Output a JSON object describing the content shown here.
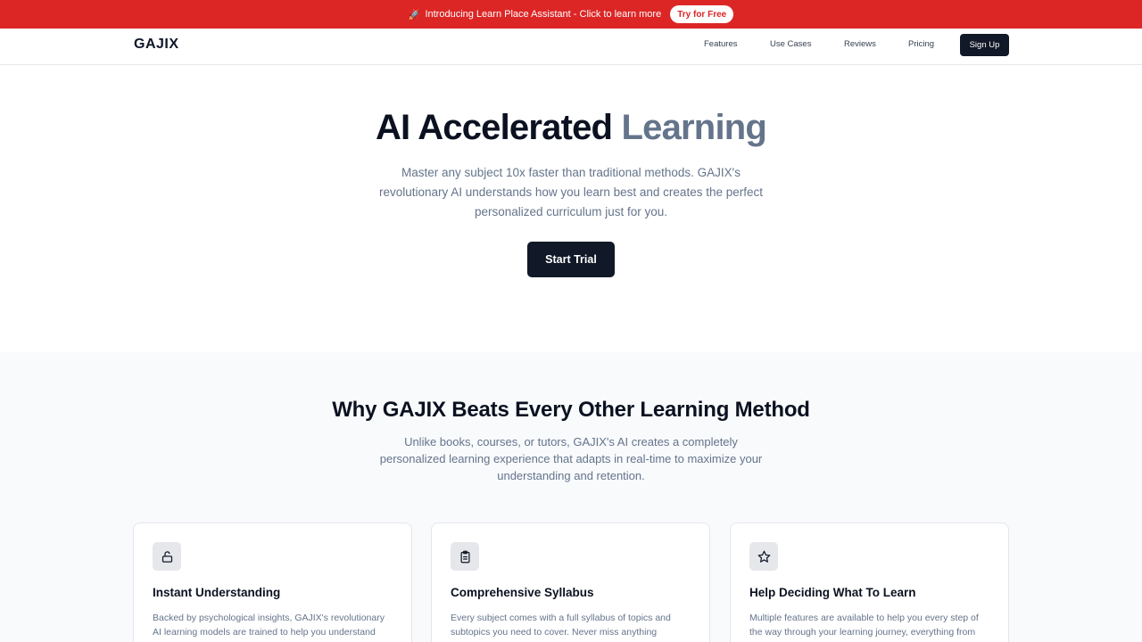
{
  "banner": {
    "rocket": "🚀",
    "text": "Introducing Learn Place Assistant - Click to learn more",
    "cta": "Try for Free"
  },
  "nav": {
    "logo": "GAJIX",
    "links": [
      "Features",
      "Use Cases",
      "Reviews",
      "Pricing"
    ],
    "signup": "Sign Up"
  },
  "hero": {
    "title_main": "AI Accelerated ",
    "title_accent": "Learning",
    "subtitle": "Master any subject 10x faster than traditional methods. GAJIX's revolutionary AI understands how you learn best and creates the perfect personalized curriculum just for you.",
    "cta": "Start Trial"
  },
  "why": {
    "title": "Why GAJIX Beats Every Other Learning Method",
    "subtitle": "Unlike books, courses, or tutors, GAJIX's AI creates a completely personalized learning experience that adapts in real-time to maximize your understanding and retention."
  },
  "cards": [
    {
      "icon": "unlock-icon",
      "title": "Instant Understanding",
      "text": "Backed by psychological insights, GAJIX's revolutionary AI learning models are trained to help you understand"
    },
    {
      "icon": "clipboard-icon",
      "title": "Comprehensive Syllabus",
      "text": "Every subject comes with a full syllabus of topics and subtopics you need to cover. Never miss anything"
    },
    {
      "icon": "star-icon",
      "title": "Help Deciding What To Learn",
      "text": "Multiple features are available to help you every step of the way through your learning journey, everything from"
    }
  ]
}
